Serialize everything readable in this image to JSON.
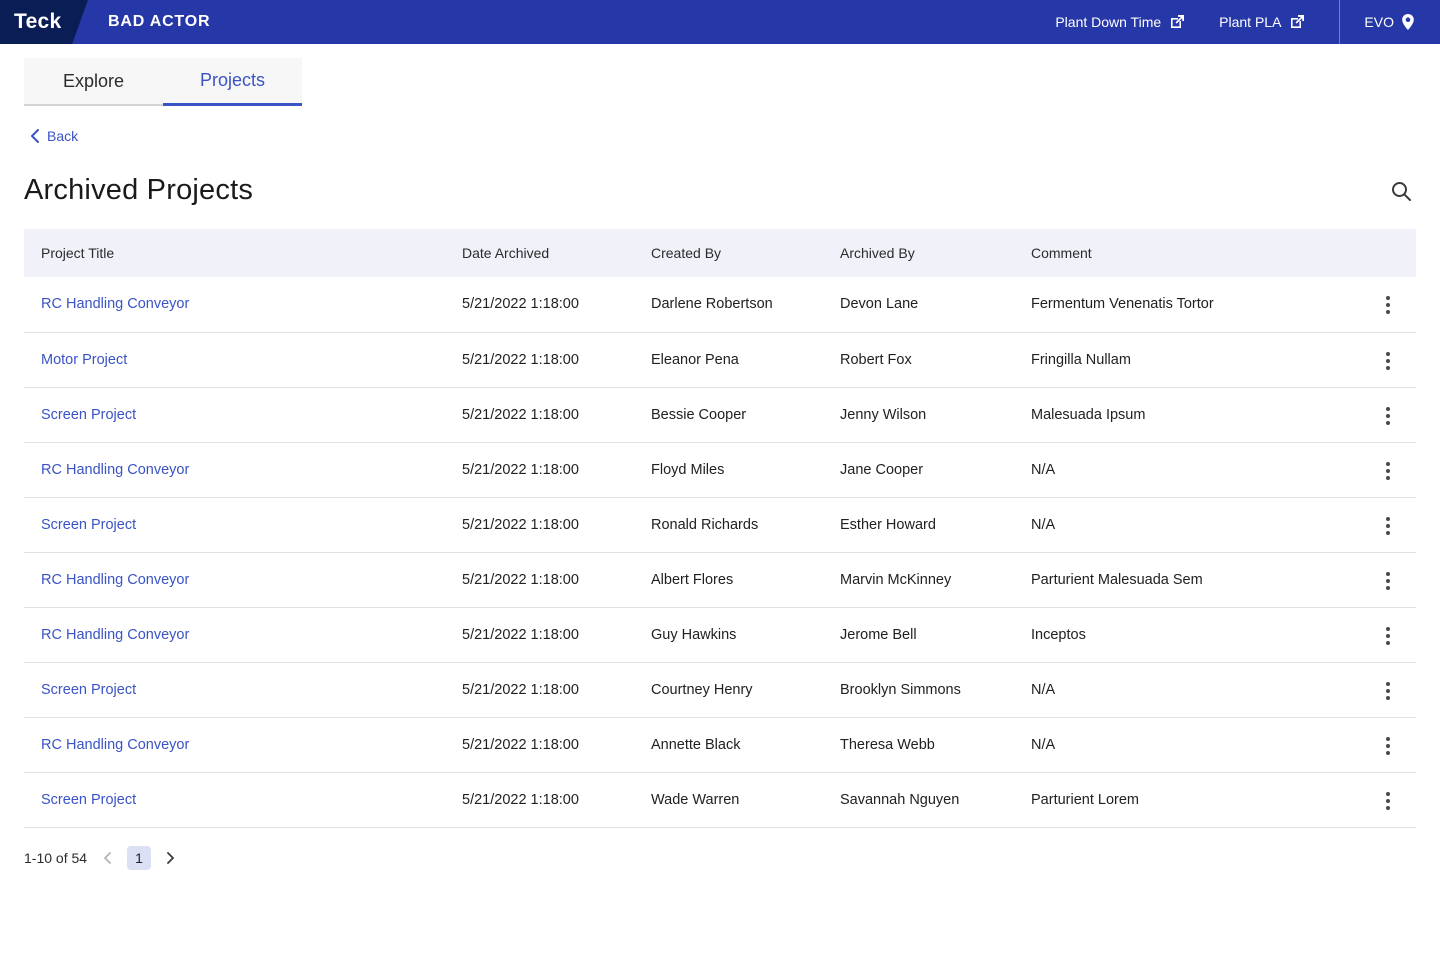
{
  "header": {
    "logo_text": "Teck",
    "app_title": "BAD ACTOR",
    "nav_links": [
      {
        "label": "Plant Down Time"
      },
      {
        "label": "Plant PLA"
      }
    ],
    "evo_label": "EVO"
  },
  "tabs": [
    {
      "label": "Explore",
      "active": false
    },
    {
      "label": "Projects",
      "active": true
    }
  ],
  "back": {
    "label": "Back"
  },
  "page": {
    "title": "Archived Projects"
  },
  "table": {
    "columns": [
      "Project Title",
      "Date Archived",
      "Created By",
      "Archived By",
      "Comment"
    ],
    "rows": [
      {
        "title": "RC Handling Conveyor",
        "date": "5/21/2022 1:18:00",
        "created_by": "Darlene Robertson",
        "archived_by": "Devon Lane",
        "comment": "Fermentum Venenatis Tortor"
      },
      {
        "title": "Motor Project",
        "date": "5/21/2022 1:18:00",
        "created_by": "Eleanor Pena",
        "archived_by": "Robert Fox",
        "comment": "Fringilla Nullam"
      },
      {
        "title": "Screen Project",
        "date": "5/21/2022 1:18:00",
        "created_by": "Bessie Cooper",
        "archived_by": "Jenny Wilson",
        "comment": "Malesuada Ipsum"
      },
      {
        "title": "RC Handling Conveyor",
        "date": "5/21/2022 1:18:00",
        "created_by": "Floyd Miles",
        "archived_by": "Jane Cooper",
        "comment": "N/A"
      },
      {
        "title": "Screen Project",
        "date": "5/21/2022 1:18:00",
        "created_by": "Ronald Richards",
        "archived_by": "Esther Howard",
        "comment": "N/A"
      },
      {
        "title": "RC Handling Conveyor",
        "date": "5/21/2022 1:18:00",
        "created_by": "Albert Flores",
        "archived_by": "Marvin McKinney",
        "comment": "Parturient Malesuada Sem"
      },
      {
        "title": "RC Handling Conveyor",
        "date": "5/21/2022 1:18:00",
        "created_by": "Guy Hawkins",
        "archived_by": "Jerome Bell",
        "comment": "Inceptos"
      },
      {
        "title": "Screen Project",
        "date": "5/21/2022 1:18:00",
        "created_by": "Courtney Henry",
        "archived_by": "Brooklyn Simmons",
        "comment": "N/A"
      },
      {
        "title": "RC Handling Conveyor",
        "date": "5/21/2022 1:18:00",
        "created_by": "Annette Black",
        "archived_by": "Theresa Webb",
        "comment": "N/A"
      },
      {
        "title": "Screen Project",
        "date": "5/21/2022 1:18:00",
        "created_by": "Wade Warren",
        "archived_by": "Savannah Nguyen",
        "comment": "Parturient Lorem"
      }
    ]
  },
  "pagination": {
    "range_label": "1-10 of 54",
    "current_page": "1"
  },
  "colors": {
    "top_bar": "#2638a8",
    "logo_bg": "#0b1d55",
    "accent_blue": "#3a53c5",
    "table_header_bg": "#f1f2f9",
    "page_chip_bg": "#dbe0f5"
  }
}
